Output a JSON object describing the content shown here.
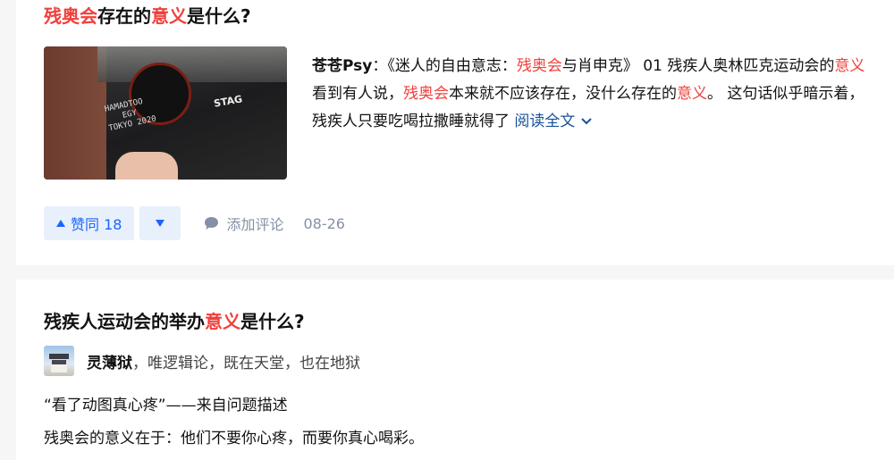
{
  "card1": {
    "title": {
      "pre": "",
      "hl1": "残奥会",
      "mid": "存在的",
      "hl2": "意义",
      "post": "是什么?"
    },
    "excerpt": {
      "author": "苍苍Psy",
      "p1": "：《迷人的自由意志：",
      "hl1": "残奥会",
      "p2": "与肖申克》 01 残疾人奥林匹克运动会的",
      "hl2": "意义",
      "p3": " 看到有人说，",
      "hl3": "残奥会",
      "p4": "本来就不应该存在，没什么存在的",
      "hl4": "意义",
      "p5": "。 这句话似乎暗示着，残疾人只要吃喝拉撒睡就得了 ",
      "read_full": "阅读全文"
    },
    "thumbnail": {
      "shirt_lines": [
        "HAMADTOO",
        "EGY",
        "TOKYO 2020"
      ],
      "logo": "STAG"
    },
    "actions": {
      "upvote_label": "赞同 18",
      "comment_label": "添加评论",
      "date": "08-26"
    }
  },
  "card2": {
    "title": {
      "pre": "残疾人运动会的举办",
      "hl": "意义",
      "post": "是什么?"
    },
    "author": {
      "name": "灵薄狱",
      "bio": "，唯逻辑论，既在天堂，也在地狱"
    },
    "line1": "“看了动图真心疼”——来自问题描述",
    "line2": "残奥会的意义在于：他们不要你心疼，而要你真心喝彩。"
  },
  "colors": {
    "highlight": "#f1403c",
    "link": "#175199",
    "vote": "#1a66ff",
    "muted": "#8590a6"
  },
  "icons": [
    "triangle-up-icon",
    "triangle-down-icon",
    "comment-bubble-icon",
    "chevron-down-icon"
  ]
}
